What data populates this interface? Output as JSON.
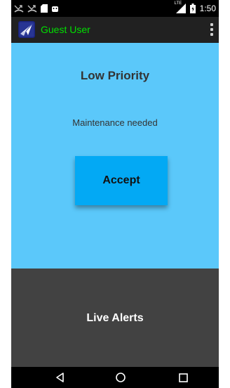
{
  "status_bar": {
    "time": "1:50",
    "network_label": "LTE",
    "left_icons": [
      "missed-call-icon",
      "missed-call-icon",
      "sd-card-icon",
      "android-debug-icon"
    ],
    "right_icons": [
      "signal-icon",
      "battery-icon"
    ]
  },
  "action_bar": {
    "app_icon": "paper-plane-logo-icon",
    "title": "Guest User",
    "title_color": "#00e000",
    "menu_icon": "overflow-menu-icon"
  },
  "alert": {
    "priority": "Low Priority",
    "message": "Maintenance needed",
    "accept_label": "Accept",
    "panel_color": "#5bc8fa",
    "button_color": "#03a9f4"
  },
  "live_alerts": {
    "label": "Live Alerts",
    "color": "#424242"
  },
  "nav_bar": {
    "icons": [
      "back-icon",
      "home-icon",
      "recents-icon"
    ]
  }
}
